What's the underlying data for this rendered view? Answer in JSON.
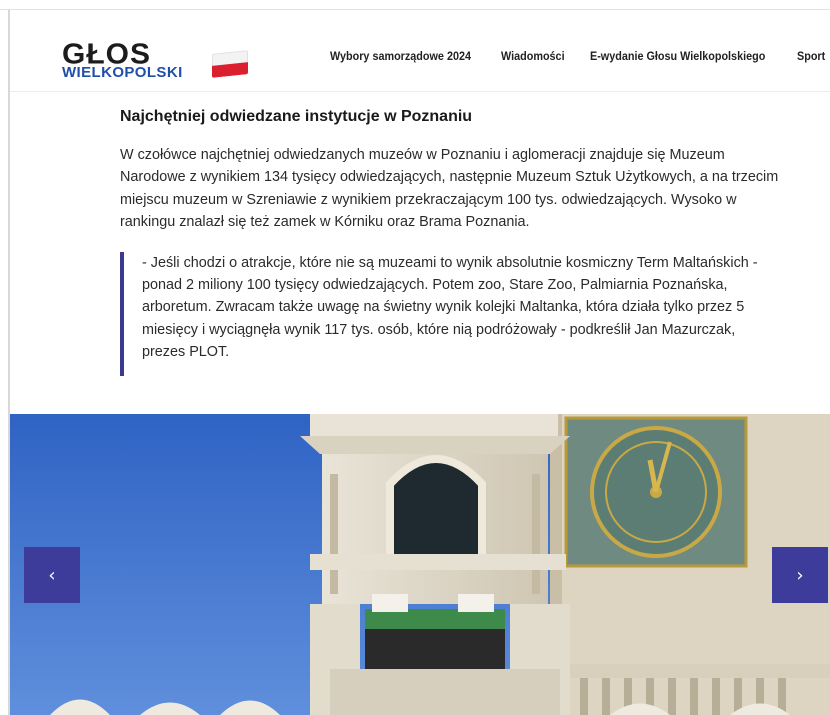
{
  "logo": {
    "top_text": "GŁOS",
    "bottom_text": "WIELKOPOLSKI"
  },
  "nav": {
    "items": [
      {
        "label": "Wybory samorządowe 2024"
      },
      {
        "label": "Wiadomości"
      },
      {
        "label": "E-wydanie Głosu Wielkopolskiego"
      },
      {
        "label": "Sport"
      }
    ]
  },
  "article": {
    "heading": "Najchętniej odwiedzane instytucje w Poznaniu",
    "paragraph_lines": [
      "W czołówce najchętniej odwiedzanych muzeów w Poznaniu i aglomeracji znajduje się Muzeum",
      "Narodowe z wynikiem 134 tysięcy odwiedzających, następnie Muzeum Sztuk Użytkowych, a na trzecim",
      "miejscu muzeum w Szreniawie z wynikiem przekraczającym 100 tys. odwiedzających. Wysoko w",
      "rankingu znalazł się też zamek w Kórniku oraz Brama Poznania."
    ],
    "quote_lines": [
      "- Jeśli chodzi o atrakcje, które nie są muzeami to wynik absolutnie kosmiczny Term Maltańskich -",
      "ponad 2 miliony 100 tysięcy odwiedzających. Potem zoo, Stare Zoo, Palmiarnia Poznańska,",
      "arboretum. Zwracam także uwagę na świetny wynik kolejki Maltanka, która działa tylko przez 5",
      "miesięcy i wyciągnęła wynik 117 tys. osób, które nią podróżowały - podkreślił Jan Mazurczak,",
      "prezes PLOT."
    ]
  },
  "gallery": {
    "prev_label": "‹",
    "next_label": "›"
  },
  "colors": {
    "accent": "#3e3c9a",
    "quote_bar": "#3b3a8f",
    "logo_blue": "#1f4fa8",
    "flag_red": "#dc1f2f"
  }
}
